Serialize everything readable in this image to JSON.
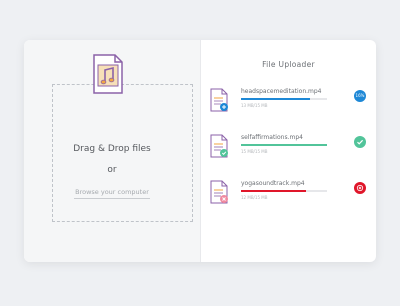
{
  "colors": {
    "blue": "#1e88d6",
    "green": "#52c49a",
    "red": "#e0162a",
    "icon_purple": "#8b62a8",
    "icon_orange": "#f2a642"
  },
  "uploader": {
    "drop_title": "Drag & Drop files",
    "drop_or": "or",
    "browse_label": "Browse your computer",
    "drop_icon": "music-file-icon"
  },
  "panel": {
    "title": "File Uploader",
    "files": [
      {
        "name": "headspacemeditation.mp4",
        "size": "13 MB/15 MB",
        "progress": 0.8,
        "status": "uploading",
        "status_text": "16%",
        "badge_icon": "upload-plus-icon"
      },
      {
        "name": "selfaffirmations.mp4",
        "size": "15 MB/15 MB",
        "progress": 1.0,
        "status": "complete",
        "status_text": "",
        "badge_icon": "checkmark-icon"
      },
      {
        "name": "yogasoundtrack.mp4",
        "size": "12 MB/15 MB",
        "progress": 0.75,
        "status": "error",
        "status_text": "",
        "badge_icon": "error-x-icon"
      }
    ]
  }
}
